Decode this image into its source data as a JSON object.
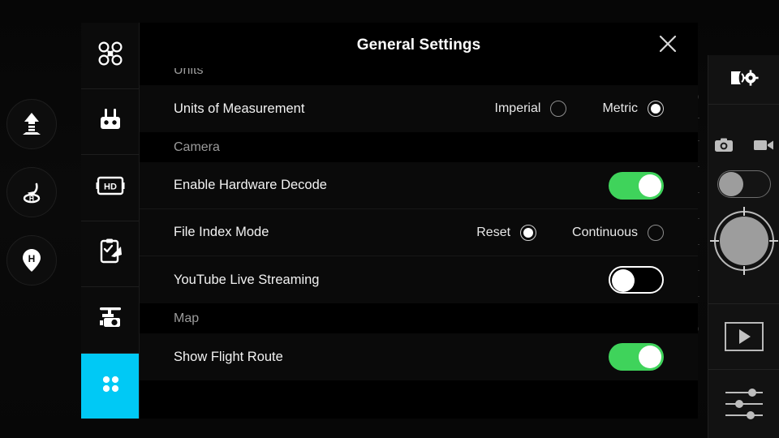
{
  "app": {
    "accent_cyan": "#00c9f5",
    "toggle_on_green": "#3fd35b"
  },
  "left_rail": {
    "buttons": [
      {
        "name": "takeoff-button",
        "icon": "takeoff-arrow-icon"
      },
      {
        "name": "return-to-home-button",
        "icon": "return-home-icon"
      },
      {
        "name": "home-point-button",
        "icon": "home-pin-icon"
      }
    ]
  },
  "sidebar": {
    "items": [
      {
        "label": "Aircraft",
        "icon": "drone-icon",
        "active": false
      },
      {
        "label": "Remote Controller",
        "icon": "remote-controller-icon",
        "active": false
      },
      {
        "label": "Image Transmission",
        "icon": "hd-icon",
        "active": false
      },
      {
        "label": "Flight Plan",
        "icon": "checklist-icon",
        "active": false
      },
      {
        "label": "Gimbal",
        "icon": "gimbal-camera-icon",
        "active": false
      },
      {
        "label": "General",
        "icon": "grid-dots-icon",
        "active": true
      }
    ]
  },
  "panel": {
    "title": "General Settings",
    "close_icon": "close-icon",
    "sections": [
      {
        "label": "Units",
        "rows": [
          {
            "label": "Units of Measurement",
            "control": "radio",
            "options": [
              {
                "text": "Imperial",
                "selected": false
              },
              {
                "text": "Metric",
                "selected": true
              }
            ]
          }
        ]
      },
      {
        "label": "Camera",
        "rows": [
          {
            "label": "Enable Hardware Decode",
            "control": "toggle",
            "value": "on"
          },
          {
            "label": "File Index Mode",
            "control": "radio",
            "options": [
              {
                "text": "Reset",
                "selected": true
              },
              {
                "text": "Continuous",
                "selected": false
              }
            ]
          },
          {
            "label": "YouTube Live Streaming",
            "control": "toggle",
            "value": "off"
          }
        ]
      },
      {
        "label": "Map",
        "rows": [
          {
            "label": "Show Flight Route",
            "control": "toggle",
            "value": "on"
          }
        ]
      }
    ]
  },
  "right_rail": {
    "camera_settings_icon": "camera-settings-icon",
    "photo_mode_icon": "photo-camera-icon",
    "video_mode_icon": "video-camera-icon",
    "capture_mode": "photo",
    "shutter_icon": "shutter-button-icon",
    "playback_icon": "playback-play-icon",
    "adjustments_icon": "sliders-icon"
  }
}
